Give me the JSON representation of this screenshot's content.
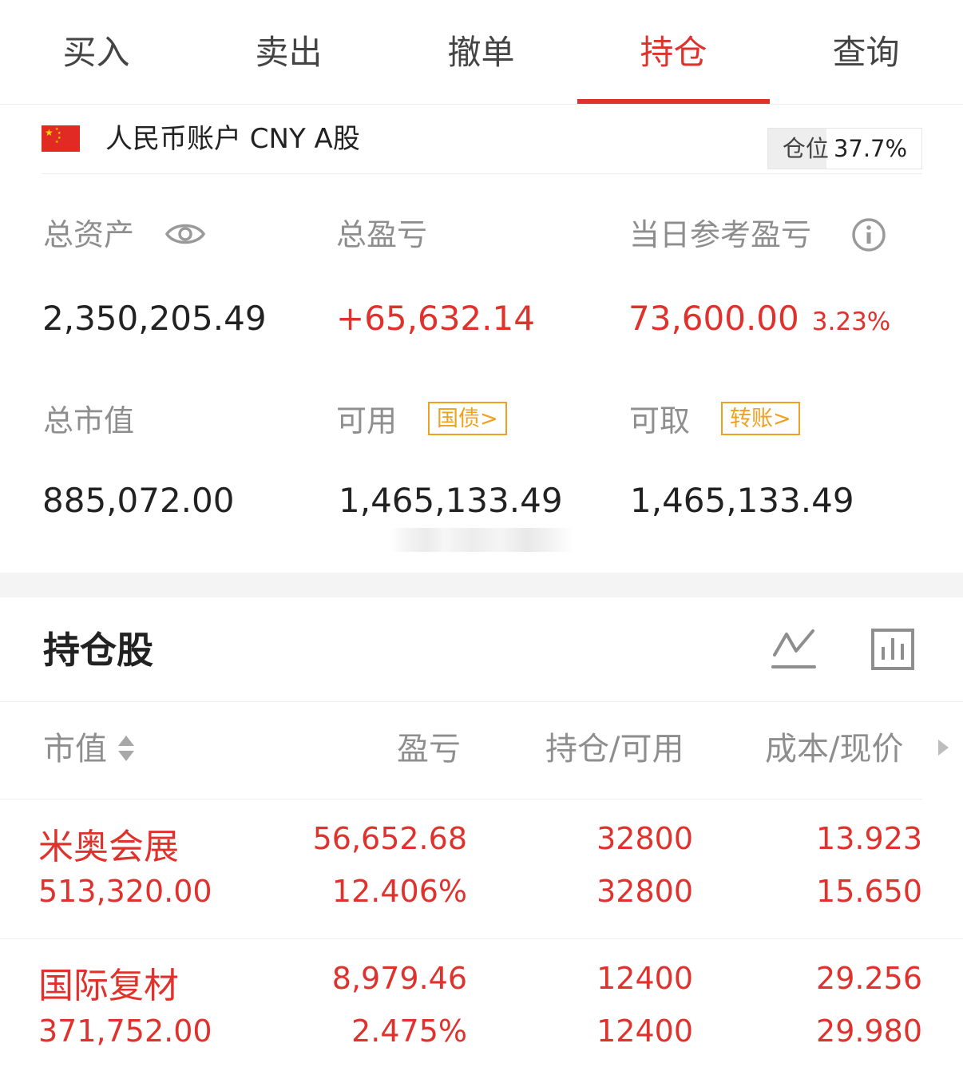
{
  "tabs": [
    {
      "label": "买入",
      "active": false
    },
    {
      "label": "卖出",
      "active": false
    },
    {
      "label": "撤单",
      "active": false
    },
    {
      "label": "持仓",
      "active": true
    },
    {
      "label": "查询",
      "active": false
    }
  ],
  "account": {
    "flag_icon": "china-flag-icon",
    "name": "人民币账户 CNY A股",
    "position_label": "仓位",
    "position_value": "37.7%"
  },
  "summary": {
    "total_assets_label": "总资产",
    "total_assets_value": "2,350,205.49",
    "total_pnl_label": "总盈亏",
    "total_pnl_value": "+65,632.14",
    "daily_pnl_label": "当日参考盈亏",
    "daily_pnl_value": "73,600.00",
    "daily_pnl_pct": "3.23%",
    "market_value_label": "总市值",
    "market_value_value": "885,072.00",
    "available_label": "可用",
    "available_tag": "国债>",
    "available_value": "1,465,133.49",
    "withdrawable_label": "可取",
    "withdrawable_tag": "转账>",
    "withdrawable_value": "1,465,133.49"
  },
  "holdings": {
    "title": "持仓股",
    "columns": {
      "market_value": "市值",
      "pnl": "盈亏",
      "position": "持仓/可用",
      "cost_price": "成本/现价"
    },
    "rows": [
      {
        "name": "米奥会展",
        "market_value": "513,320.00",
        "pnl": "56,652.68",
        "pnl_pct": "12.406%",
        "position": "32800",
        "available": "32800",
        "cost": "13.923",
        "price": "15.650"
      },
      {
        "name": "国际复材",
        "market_value": "371,752.00",
        "pnl": "8,979.46",
        "pnl_pct": "2.475%",
        "position": "12400",
        "available": "12400",
        "cost": "29.256",
        "price": "29.980"
      }
    ]
  },
  "colors": {
    "accent_red": "#e0322d",
    "tag_orange": "#f0a020",
    "label_gray": "#8e8e8e"
  }
}
